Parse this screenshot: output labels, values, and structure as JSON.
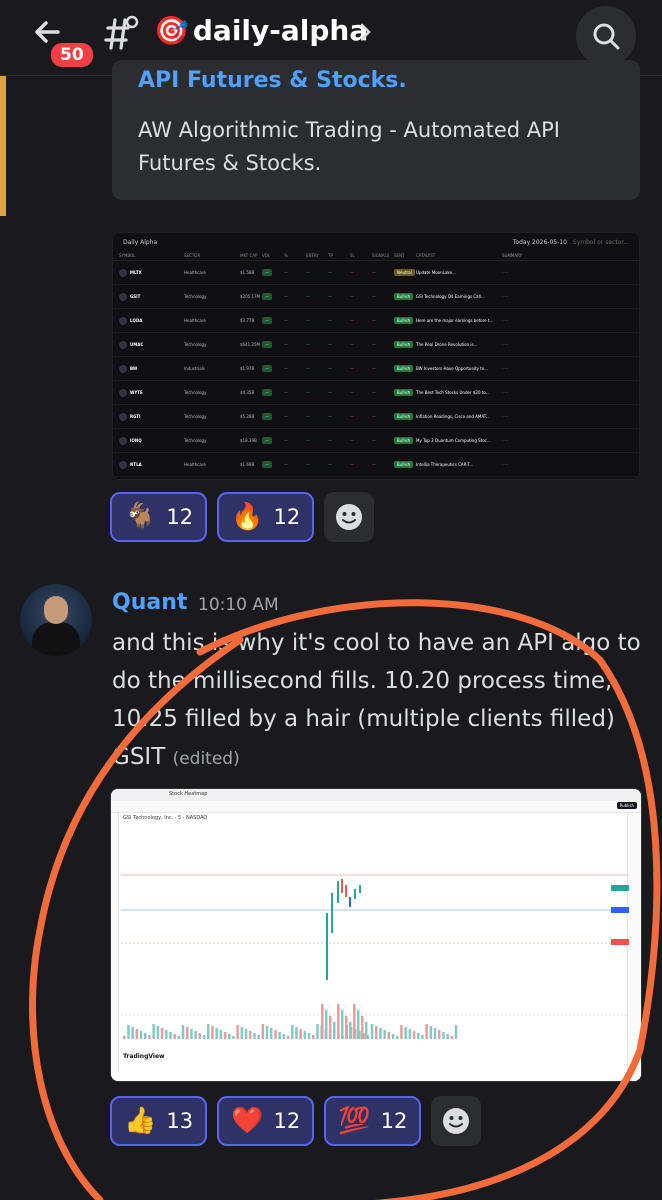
{
  "header": {
    "unread_count": "50",
    "channel_emoji": "🎯",
    "channel_name": "daily-alpha"
  },
  "embed": {
    "title": "API Futures & Stocks.",
    "description": "AW Algorithmic Trading - Automated API Futures & Stocks."
  },
  "table_image": {
    "title": "Daily Alpha",
    "date_label": "Today 2026-05-10",
    "search_placeholder": "Symbol or sector...",
    "rows": [
      {
        "sym": "MLTX",
        "sector": "Healthcare",
        "cap": "$1.58B",
        "sent": "Neutral",
        "catalyst": "Update MoonLake..."
      },
      {
        "sym": "GSIT",
        "sector": "Technology",
        "cap": "$205.17M",
        "sent": "Bullish",
        "catalyst": "GSI Technology Q4 Earnings Call..."
      },
      {
        "sym": "LQDA",
        "sector": "Healthcare",
        "cap": "$3.77B",
        "sent": "Bullish",
        "catalyst": "Here are the major earnings before t..."
      },
      {
        "sym": "UMAC",
        "sector": "Technology",
        "cap": "$641.25M",
        "sent": "Bullish",
        "catalyst": "The Real Drone Revolution is..."
      },
      {
        "sym": "BW",
        "sector": "Industrials",
        "cap": "$1.97B",
        "sent": "Bullish",
        "catalyst": "BW Investors Have Opportunity to..."
      },
      {
        "sym": "WYTE",
        "sector": "Technology",
        "cap": "$4.35B",
        "sent": "Bullish",
        "catalyst": "The Best Tech Stocks Under $20 to..."
      },
      {
        "sym": "RGTI",
        "sector": "Technology",
        "cap": "$5.28B",
        "sent": "Bullish",
        "catalyst": "Inflation Readings, Cisco and AMAT..."
      },
      {
        "sym": "IONQ",
        "sector": "Technology",
        "cap": "$18.39B",
        "sent": "Bullish",
        "catalyst": "My Top 3 Quantum Computing Stoc..."
      },
      {
        "sym": "NTLA",
        "sector": "Healthcare",
        "cap": "$1.69B",
        "sent": "Bullish",
        "catalyst": "Intellia Therapeutics CAR-T..."
      }
    ]
  },
  "reactions_1": [
    {
      "emoji": "🐐",
      "count": "12"
    },
    {
      "emoji": "🔥",
      "count": "12"
    }
  ],
  "message": {
    "author": "Quant",
    "time": "10:10 AM",
    "text": "and this is why it's cool to have an API algo to do the millisecond fills. 10.20 process time, 10.25 filled by a hair (multiple clients filled) GSIT",
    "edited": "(edited)"
  },
  "chart_image": {
    "tab_label": "Stock Heatmap",
    "ticker_line": "GSI Technology, Inc. · 5 · NASDAQ",
    "brand": "TradingView",
    "publish_label": "Publish"
  },
  "reactions_2": [
    {
      "emoji": "👍",
      "count": "13"
    },
    {
      "emoji": "❤️",
      "count": "12"
    },
    {
      "emoji": "💯",
      "count": "12"
    }
  ],
  "colors": {
    "accent": "#4ea1ff",
    "annotation": "#f26b3a",
    "badge": "#f23f43"
  }
}
